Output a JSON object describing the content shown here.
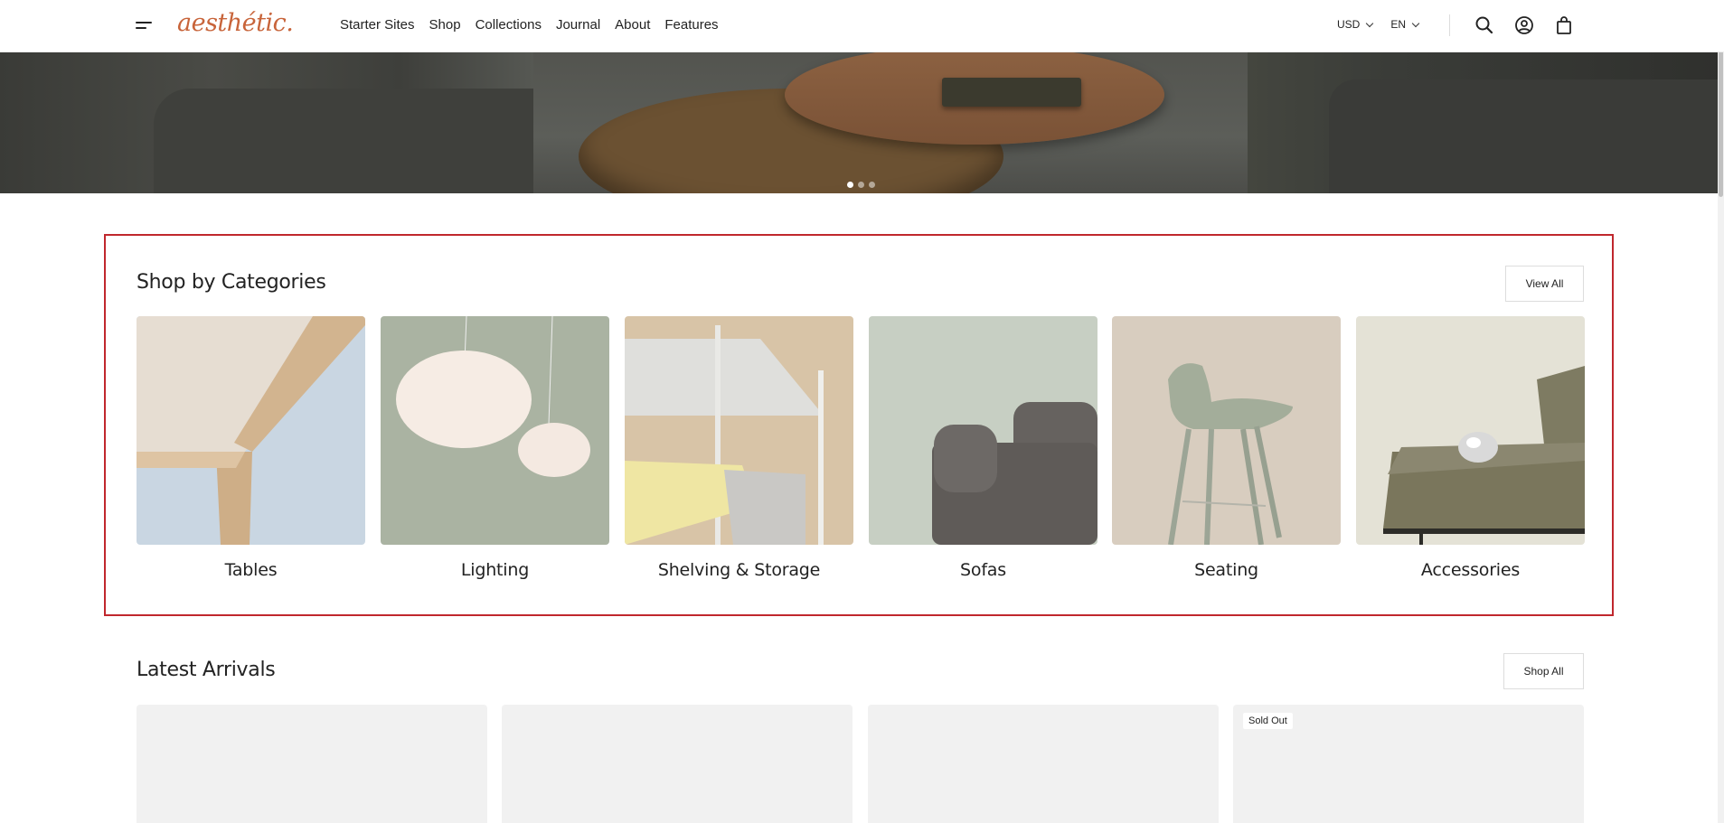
{
  "header": {
    "logo": "aesthétic.",
    "nav": [
      "Starter Sites",
      "Shop",
      "Collections",
      "Journal",
      "About",
      "Features"
    ],
    "currency": "USD",
    "language": "EN",
    "icons": [
      "menu-icon",
      "search-icon",
      "account-icon",
      "cart-icon"
    ]
  },
  "hero": {
    "slides_total": 3,
    "active_slide": 1
  },
  "categories": {
    "title": "Shop by Categories",
    "view_all": "View All",
    "items": [
      {
        "label": "Tables"
      },
      {
        "label": "Lighting"
      },
      {
        "label": "Shelving & Storage"
      },
      {
        "label": "Sofas"
      },
      {
        "label": "Seating"
      },
      {
        "label": "Accessories"
      }
    ]
  },
  "latest": {
    "title": "Latest Arrivals",
    "shop_all": "Shop All",
    "products": [
      {
        "badge": ""
      },
      {
        "badge": ""
      },
      {
        "badge": ""
      },
      {
        "badge": "Sold Out"
      }
    ]
  },
  "colors": {
    "brand": "#c8643a",
    "highlight_border": "#c0272d"
  }
}
